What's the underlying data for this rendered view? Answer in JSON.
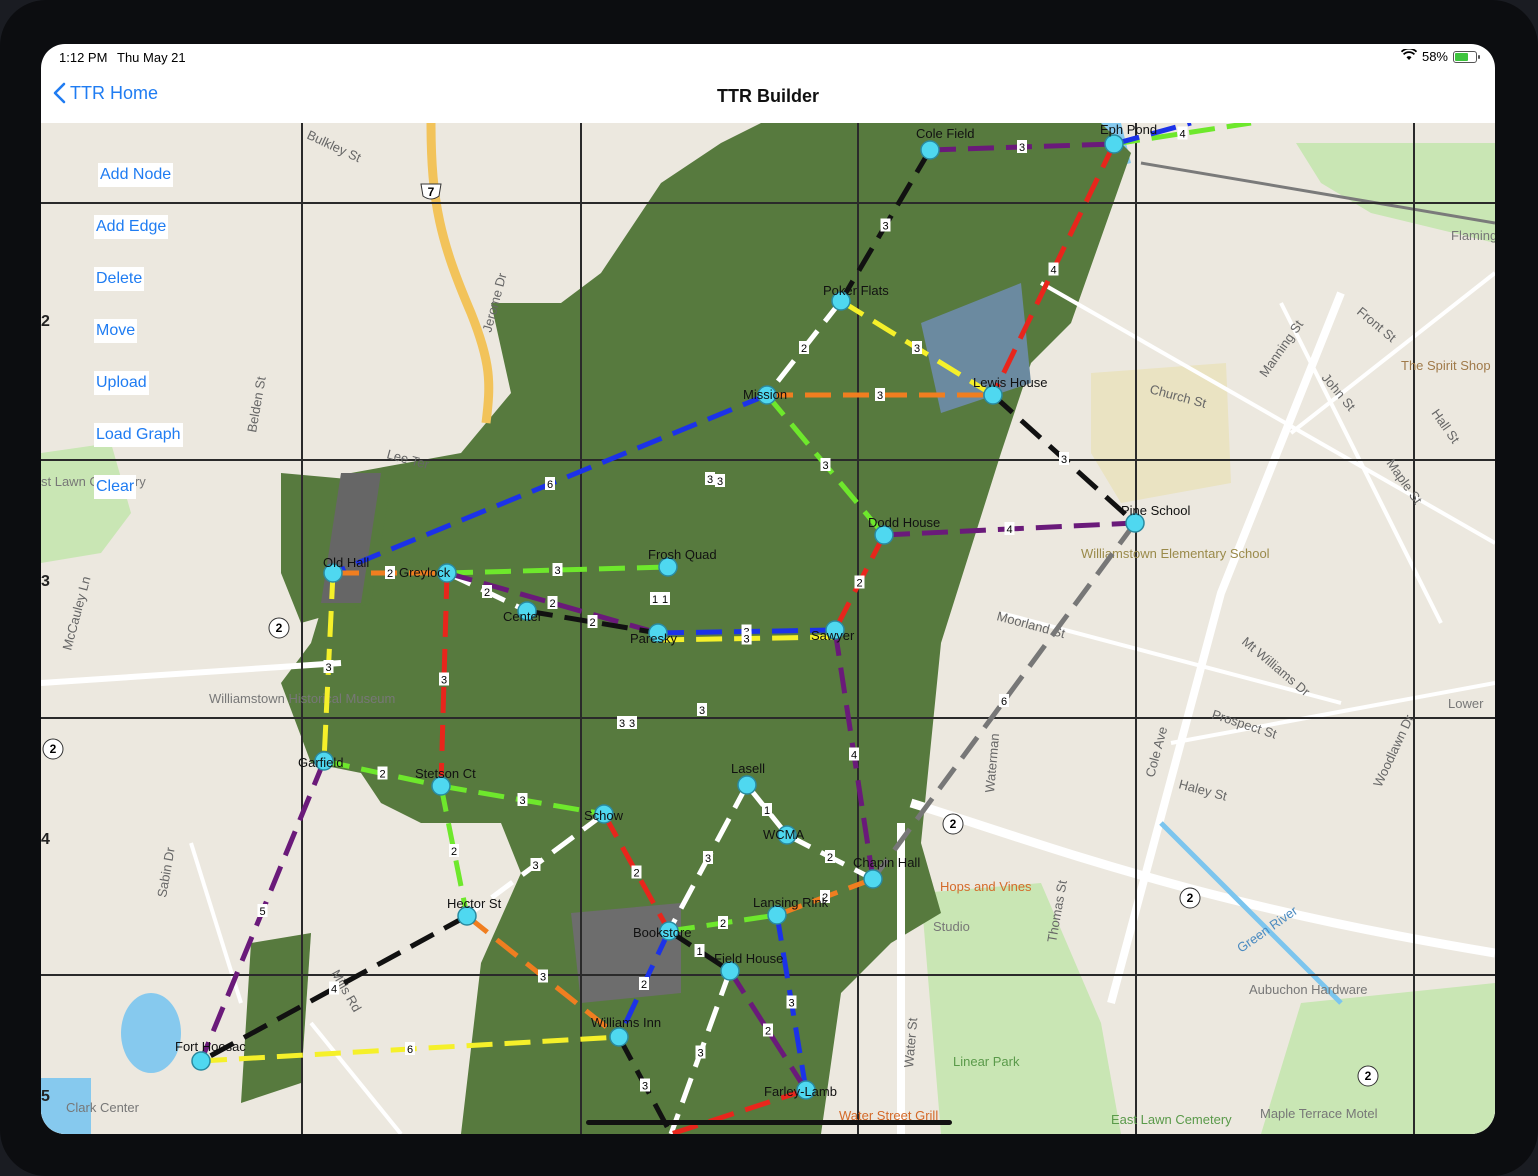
{
  "status_bar": {
    "time": "1:12 PM",
    "date": "Thu May 21",
    "battery": "58%"
  },
  "nav": {
    "back_label": "TTR Home",
    "title": "TTR Builder"
  },
  "toolbar": [
    "Add Node",
    "Add Edge",
    "Delete",
    "Move",
    "Upload",
    "Load Graph",
    "Clear"
  ],
  "grid_row_labels": [
    "2",
    "3",
    "4",
    "5"
  ],
  "map_labels": {
    "streets": [
      "Bulkley St",
      "Jerome Dr",
      "Belden St",
      "Lee Ter",
      "McCauley Ln",
      "Sabin Dr",
      "Mills Rd",
      "Water St",
      "Waterman",
      "Thomas St",
      "Cole Ave",
      "Church St",
      "Moorland St",
      "Mt Williams Dr",
      "Prospect St",
      "Haley St",
      "Woodlawn Dr",
      "Manning St",
      "John St",
      "Front St",
      "Hall St",
      "Maple St"
    ],
    "places": [
      "Williamstown Elementary School",
      "Williamstown Historical Museum",
      "Hops and Vines",
      "Studio",
      "Green River",
      "Aubuchon Hardware",
      "Linear Park",
      "Water Street Grill",
      "East Lawn Cemetery",
      "Maple Terrace Motel",
      "Clark Center",
      "The Spirit Shop",
      "Flamingo",
      "Lower",
      "st Lawn Cemetery"
    ],
    "route_shields": [
      "7",
      "2",
      "2",
      "2",
      "2",
      "2"
    ]
  },
  "colors": {
    "accent": "#1f7cf2",
    "node": "#4fd8f0",
    "red": "#e8261c",
    "blue": "#1c32e8",
    "green": "#6ee82c",
    "yellow": "#f5f02a",
    "orange": "#f07e20",
    "purple": "#6a1a7a",
    "black": "#111111",
    "white": "#ffffff",
    "gray": "#777777"
  },
  "graph": {
    "nodes": [
      {
        "id": "cole",
        "label": "Cole Field"
      },
      {
        "id": "epl",
        "label": "Eph Pond"
      },
      {
        "id": "poker",
        "label": "Poker Flats"
      },
      {
        "id": "mission",
        "label": "Mission"
      },
      {
        "id": "lewis",
        "label": "Lewis House"
      },
      {
        "id": "pine",
        "label": "Pine School"
      },
      {
        "id": "dodd",
        "label": "Dodd House"
      },
      {
        "id": "old",
        "label": "Old Hall"
      },
      {
        "id": "greylock",
        "label": "Greylock"
      },
      {
        "id": "center",
        "label": "Center"
      },
      {
        "id": "frosh",
        "label": "Frosh Quad"
      },
      {
        "id": "paresky",
        "label": "Paresky"
      },
      {
        "id": "sawyer",
        "label": "Sawyer"
      },
      {
        "id": "garfield",
        "label": "Garfield"
      },
      {
        "id": "stetson",
        "label": "Stetson Ct"
      },
      {
        "id": "schow",
        "label": "Schow"
      },
      {
        "id": "lasell",
        "label": "Lasell"
      },
      {
        "id": "wcma",
        "label": "WCMA"
      },
      {
        "id": "chapin",
        "label": "Chapin Hall"
      },
      {
        "id": "hector",
        "label": "Hector St"
      },
      {
        "id": "bookstore",
        "label": "Bookstore"
      },
      {
        "id": "lansing",
        "label": "Lansing Rink"
      },
      {
        "id": "field",
        "label": "Field House"
      },
      {
        "id": "hoosac",
        "label": "Fort Hoosac"
      },
      {
        "id": "williams",
        "label": "Williams Inn"
      },
      {
        "id": "farley",
        "label": "Farley-Lamb"
      }
    ],
    "edges": [
      {
        "from": "cole",
        "to": "epl",
        "color": "purple",
        "weight": "3"
      },
      {
        "from": "cole",
        "to": "poker",
        "color": "black",
        "weight": "3"
      },
      {
        "from": "epl",
        "to": "lewis",
        "color": "red",
        "weight": "4"
      },
      {
        "from": "epl",
        "to": "top_right",
        "color": "green",
        "weight": "4"
      },
      {
        "from": "epl",
        "to": "top_right_blue",
        "color": "blue",
        "weight": ""
      },
      {
        "from": "poker",
        "to": "mission",
        "color": "white",
        "weight": "2"
      },
      {
        "from": "poker",
        "to": "lewis",
        "color": "yellow",
        "weight": "3"
      },
      {
        "from": "mission",
        "to": "lewis",
        "color": "orange",
        "weight": "3"
      },
      {
        "from": "lewis",
        "to": "pine",
        "color": "black",
        "weight": "3"
      },
      {
        "from": "mission",
        "to": "dodd",
        "color": "green",
        "weight": "3"
      },
      {
        "from": "mission",
        "to": "old",
        "color": "blue",
        "weight": "6"
      },
      {
        "from": "dodd",
        "to": "pine",
        "color": "purple",
        "weight": "4"
      },
      {
        "from": "dodd",
        "to": "sawyer",
        "color": "red",
        "weight": "2"
      },
      {
        "from": "pine",
        "to": "chapin",
        "color": "gray",
        "weight": "6"
      },
      {
        "from": "old",
        "to": "greylock",
        "color": "orange",
        "weight": "2"
      },
      {
        "from": "old",
        "to": "garfield",
        "color": "yellow",
        "weight": "3"
      },
      {
        "from": "greylock",
        "to": "frosh",
        "color": "green",
        "weight": "3"
      },
      {
        "from": "greylock",
        "to": "center",
        "color": "white",
        "weight": "2"
      },
      {
        "from": "greylock",
        "to": "paresky",
        "color": "purple",
        "weight": "2"
      },
      {
        "from": "center",
        "to": "paresky",
        "color": "black",
        "weight": "2"
      },
      {
        "from": "greylock",
        "to": "stetson",
        "color": "red",
        "weight": "3"
      },
      {
        "from": "paresky",
        "to": "sawyer",
        "color": "blue",
        "weight": "3"
      },
      {
        "from": "paresky",
        "to": "sawyer",
        "color": "yellow",
        "weight": "3"
      },
      {
        "from": "sawyer",
        "to": "chapin",
        "color": "purple",
        "weight": "4"
      },
      {
        "from": "garfield",
        "to": "stetson",
        "color": "green",
        "weight": "2"
      },
      {
        "from": "garfield",
        "to": "hoosac",
        "color": "purple",
        "weight": "5"
      },
      {
        "from": "stetson",
        "to": "schow",
        "color": "green",
        "weight": "3"
      },
      {
        "from": "stetson",
        "to": "hector",
        "color": "green",
        "weight": "2"
      },
      {
        "from": "schow",
        "to": "hector",
        "color": "white",
        "weight": "3"
      },
      {
        "from": "schow",
        "to": "bookstore",
        "color": "red",
        "weight": "2"
      },
      {
        "from": "lasell",
        "to": "bookstore",
        "color": "white",
        "weight": "3"
      },
      {
        "from": "lasell",
        "to": "wcma",
        "color": "white",
        "weight": "1"
      },
      {
        "from": "wcma",
        "to": "chapin",
        "color": "white",
        "weight": "2"
      },
      {
        "from": "chapin",
        "to": "lansing",
        "color": "orange",
        "weight": "2"
      },
      {
        "from": "bookstore",
        "to": "lansing",
        "color": "green",
        "weight": "2"
      },
      {
        "from": "bookstore",
        "to": "field",
        "color": "black",
        "weight": "1"
      },
      {
        "from": "bookstore",
        "to": "williams",
        "color": "blue",
        "weight": "2"
      },
      {
        "from": "lansing",
        "to": "farley",
        "color": "blue",
        "weight": "3"
      },
      {
        "from": "field",
        "to": "farley",
        "color": "purple",
        "weight": "2"
      },
      {
        "from": "field",
        "to": "bottom",
        "color": "white",
        "weight": "3"
      },
      {
        "from": "hector",
        "to": "williams",
        "color": "orange",
        "weight": "3"
      },
      {
        "from": "hector",
        "to": "hoosac",
        "color": "black",
        "weight": "4"
      },
      {
        "from": "hoosac",
        "to": "williams",
        "color": "yellow",
        "weight": "6"
      },
      {
        "from": "williams",
        "to": "bottom",
        "color": "black",
        "weight": "3"
      },
      {
        "from": "farley",
        "to": "bottom",
        "color": "red",
        "weight": ""
      }
    ],
    "extra_weight_labels": [
      "3",
      "3",
      "1",
      "1",
      "3",
      "3",
      "3"
    ]
  }
}
